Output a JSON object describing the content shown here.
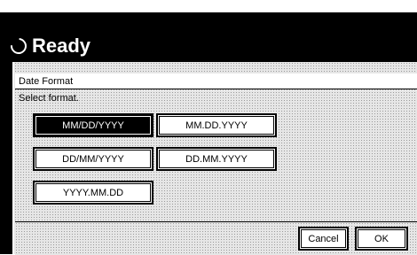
{
  "header": {
    "status_title": "Ready"
  },
  "dialog": {
    "title": "Date Format",
    "instruction": "Select format.",
    "options": [
      {
        "label": "MM/DD/YYYY",
        "selected": true
      },
      {
        "label": "MM.DD.YYYY",
        "selected": false
      },
      {
        "label": "DD/MM/YYYY",
        "selected": false
      },
      {
        "label": "DD.MM.YYYY",
        "selected": false
      },
      {
        "label": "YYYY.MM.DD",
        "selected": false
      }
    ],
    "cancel_label": "Cancel",
    "ok_label": "OK"
  },
  "colors": {
    "screen_background": "#000000",
    "selected_button": "#000000",
    "button_background": "#ffffff"
  },
  "icons": {
    "status": "ready-circle-icon"
  }
}
